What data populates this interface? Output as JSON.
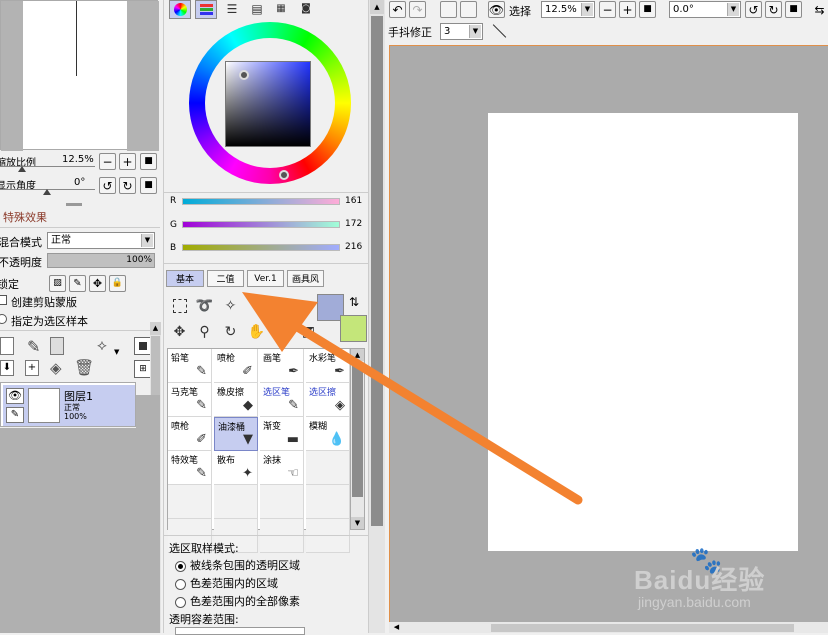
{
  "navigator": {
    "zoom_label": "缩放比例",
    "zoom_value": "12.5%",
    "angle_label": "显示角度",
    "angle_value": "0°",
    "minus": "−",
    "plus": "+",
    "reset": "■",
    "rotate_left": "↺",
    "rotate_right": "↻"
  },
  "effects": {
    "title": "特殊效果"
  },
  "layer_props": {
    "blend_label": "混合模式",
    "blend_value": "正常",
    "opacity_label": "不透明度",
    "opacity_value": "100%",
    "opacity_level": 1.0,
    "lock_label": "锁定",
    "clip_mask_label": "创建剪贴蒙版",
    "sample_source_label": "指定为选区样本"
  },
  "layers": [
    {
      "name": "图层1",
      "mode": "正常",
      "opacity": "100%"
    }
  ],
  "color": {
    "r_label": "R",
    "r_value": "161",
    "r": 161,
    "g_label": "G",
    "g_value": "172",
    "g": 172,
    "b_label": "B",
    "b_value": "216",
    "b": 216,
    "primary": "#a1acd8",
    "secondary": "#c4e67a"
  },
  "tool_tabs": [
    "基本",
    "二值",
    "Ver.1",
    "画具风"
  ],
  "brushes": [
    {
      "label": "铅笔",
      "icon": "pencil-icon",
      "glyph": "✎",
      "blue": false,
      "active": false
    },
    {
      "label": "喷枪",
      "icon": "airbrush-icon",
      "glyph": "✐",
      "blue": false,
      "active": false
    },
    {
      "label": "画笔",
      "icon": "brush-icon",
      "glyph": "✒",
      "blue": false,
      "active": false
    },
    {
      "label": "水彩笔",
      "icon": "watercolor-icon",
      "glyph": "✒",
      "blue": false,
      "active": false
    },
    {
      "label": "马克笔",
      "icon": "marker-icon",
      "glyph": "✎",
      "blue": false,
      "active": false
    },
    {
      "label": "橡皮擦",
      "icon": "eraser-icon",
      "glyph": "◆",
      "blue": false,
      "active": false
    },
    {
      "label": "选区笔",
      "icon": "selection-pen-icon",
      "glyph": "✎",
      "blue": true,
      "active": false
    },
    {
      "label": "选区擦",
      "icon": "selection-eraser-icon",
      "glyph": "◈",
      "blue": true,
      "active": false
    },
    {
      "label": "喷枪",
      "icon": "airbrush-icon",
      "glyph": "✐",
      "blue": false,
      "active": false
    },
    {
      "label": "油漆桶",
      "icon": "bucket-icon",
      "glyph": "▼",
      "blue": false,
      "active": true
    },
    {
      "label": "渐变",
      "icon": "gradient-icon",
      "glyph": "▬",
      "blue": false,
      "active": false
    },
    {
      "label": "模糊",
      "icon": "blur-icon",
      "glyph": "💧",
      "blue": false,
      "active": false
    },
    {
      "label": "特效笔",
      "icon": "effect-pen-icon",
      "glyph": "✎",
      "blue": false,
      "active": false
    },
    {
      "label": "散布",
      "icon": "scatter-icon",
      "glyph": "✦",
      "blue": false,
      "active": false
    },
    {
      "label": "涂抹",
      "icon": "smudge-icon",
      "glyph": "☜",
      "blue": false,
      "active": false
    }
  ],
  "selection_mode": {
    "title": "选区取样模式:",
    "options": [
      "被线条包围的透明区域",
      "色差范围内的区域",
      "色差范围内的全部像素"
    ],
    "selected": 0,
    "tolerance_label": "透明容差范围:"
  },
  "toolbar": {
    "select_label": "选择",
    "zoom_value": "12.5%",
    "angle_value": "0.0°",
    "stabilizer_label": "手抖修正",
    "stabilizer_value": "3"
  },
  "watermark": {
    "brand": "Baidu经验",
    "url": "jingyan.baidu.com"
  }
}
